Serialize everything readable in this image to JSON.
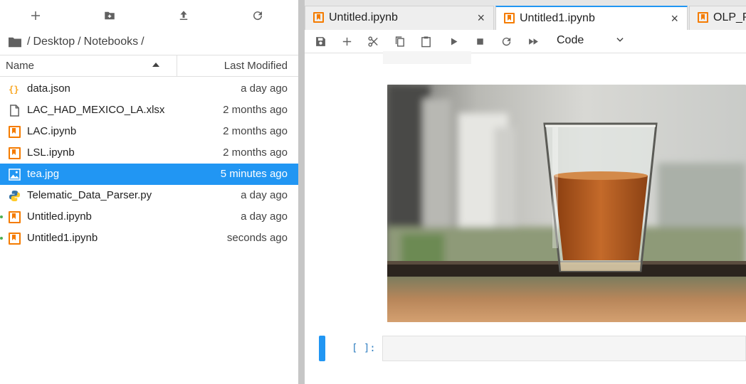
{
  "filebrowser": {
    "toolbar": [
      "new-launcher-icon",
      "new-folder-icon",
      "upload-icon",
      "refresh-icon"
    ],
    "breadcrumb": {
      "sep1": "/",
      "part1": "Desktop",
      "sep2": "/",
      "part2": "Notebooks",
      "sep3": "/"
    },
    "headers": {
      "name": "Name",
      "modified": "Last Modified"
    },
    "files": [
      {
        "name": "data.json",
        "modified": "a day ago",
        "icon": "json-icon"
      },
      {
        "name": "LAC_HAD_MEXICO_LA.xlsx",
        "modified": "2 months ago",
        "icon": "file-icon"
      },
      {
        "name": "LAC.ipynb",
        "modified": "2 months ago",
        "icon": "notebook-icon"
      },
      {
        "name": "LSL.ipynb",
        "modified": "2 months ago",
        "icon": "notebook-icon"
      },
      {
        "name": "tea.jpg",
        "modified": "5 minutes ago",
        "icon": "image-icon",
        "selected": true
      },
      {
        "name": "Telematic_Data_Parser.py",
        "modified": "a day ago",
        "icon": "python-icon"
      },
      {
        "name": "Untitled.ipynb",
        "modified": "a day ago",
        "icon": "notebook-icon",
        "running": true
      },
      {
        "name": "Untitled1.ipynb",
        "modified": "seconds ago",
        "icon": "notebook-icon",
        "running": true
      }
    ],
    "selected_color": "#2196f3",
    "running_color": "#4caf50"
  },
  "tabs": [
    {
      "label": "Untitled.ipynb",
      "close": "×"
    },
    {
      "label": "Untitled1.ipynb",
      "close": "×",
      "active": true
    },
    {
      "label": "OLP_PC"
    }
  ],
  "notebook_toolbar": {
    "icons": [
      "save-icon",
      "insert-cell-icon",
      "cut-icon",
      "copy-icon",
      "paste-icon",
      "run-icon",
      "stop-icon",
      "restart-icon",
      "run-all-icon"
    ],
    "cell_type": "Code"
  },
  "cell": {
    "prompt": "[ ]:",
    "text": ""
  },
  "output_image": {
    "subject": "glass-of-tea-photo"
  },
  "accent": "#2196f3",
  "notebook_icon_color": "#f57c00"
}
